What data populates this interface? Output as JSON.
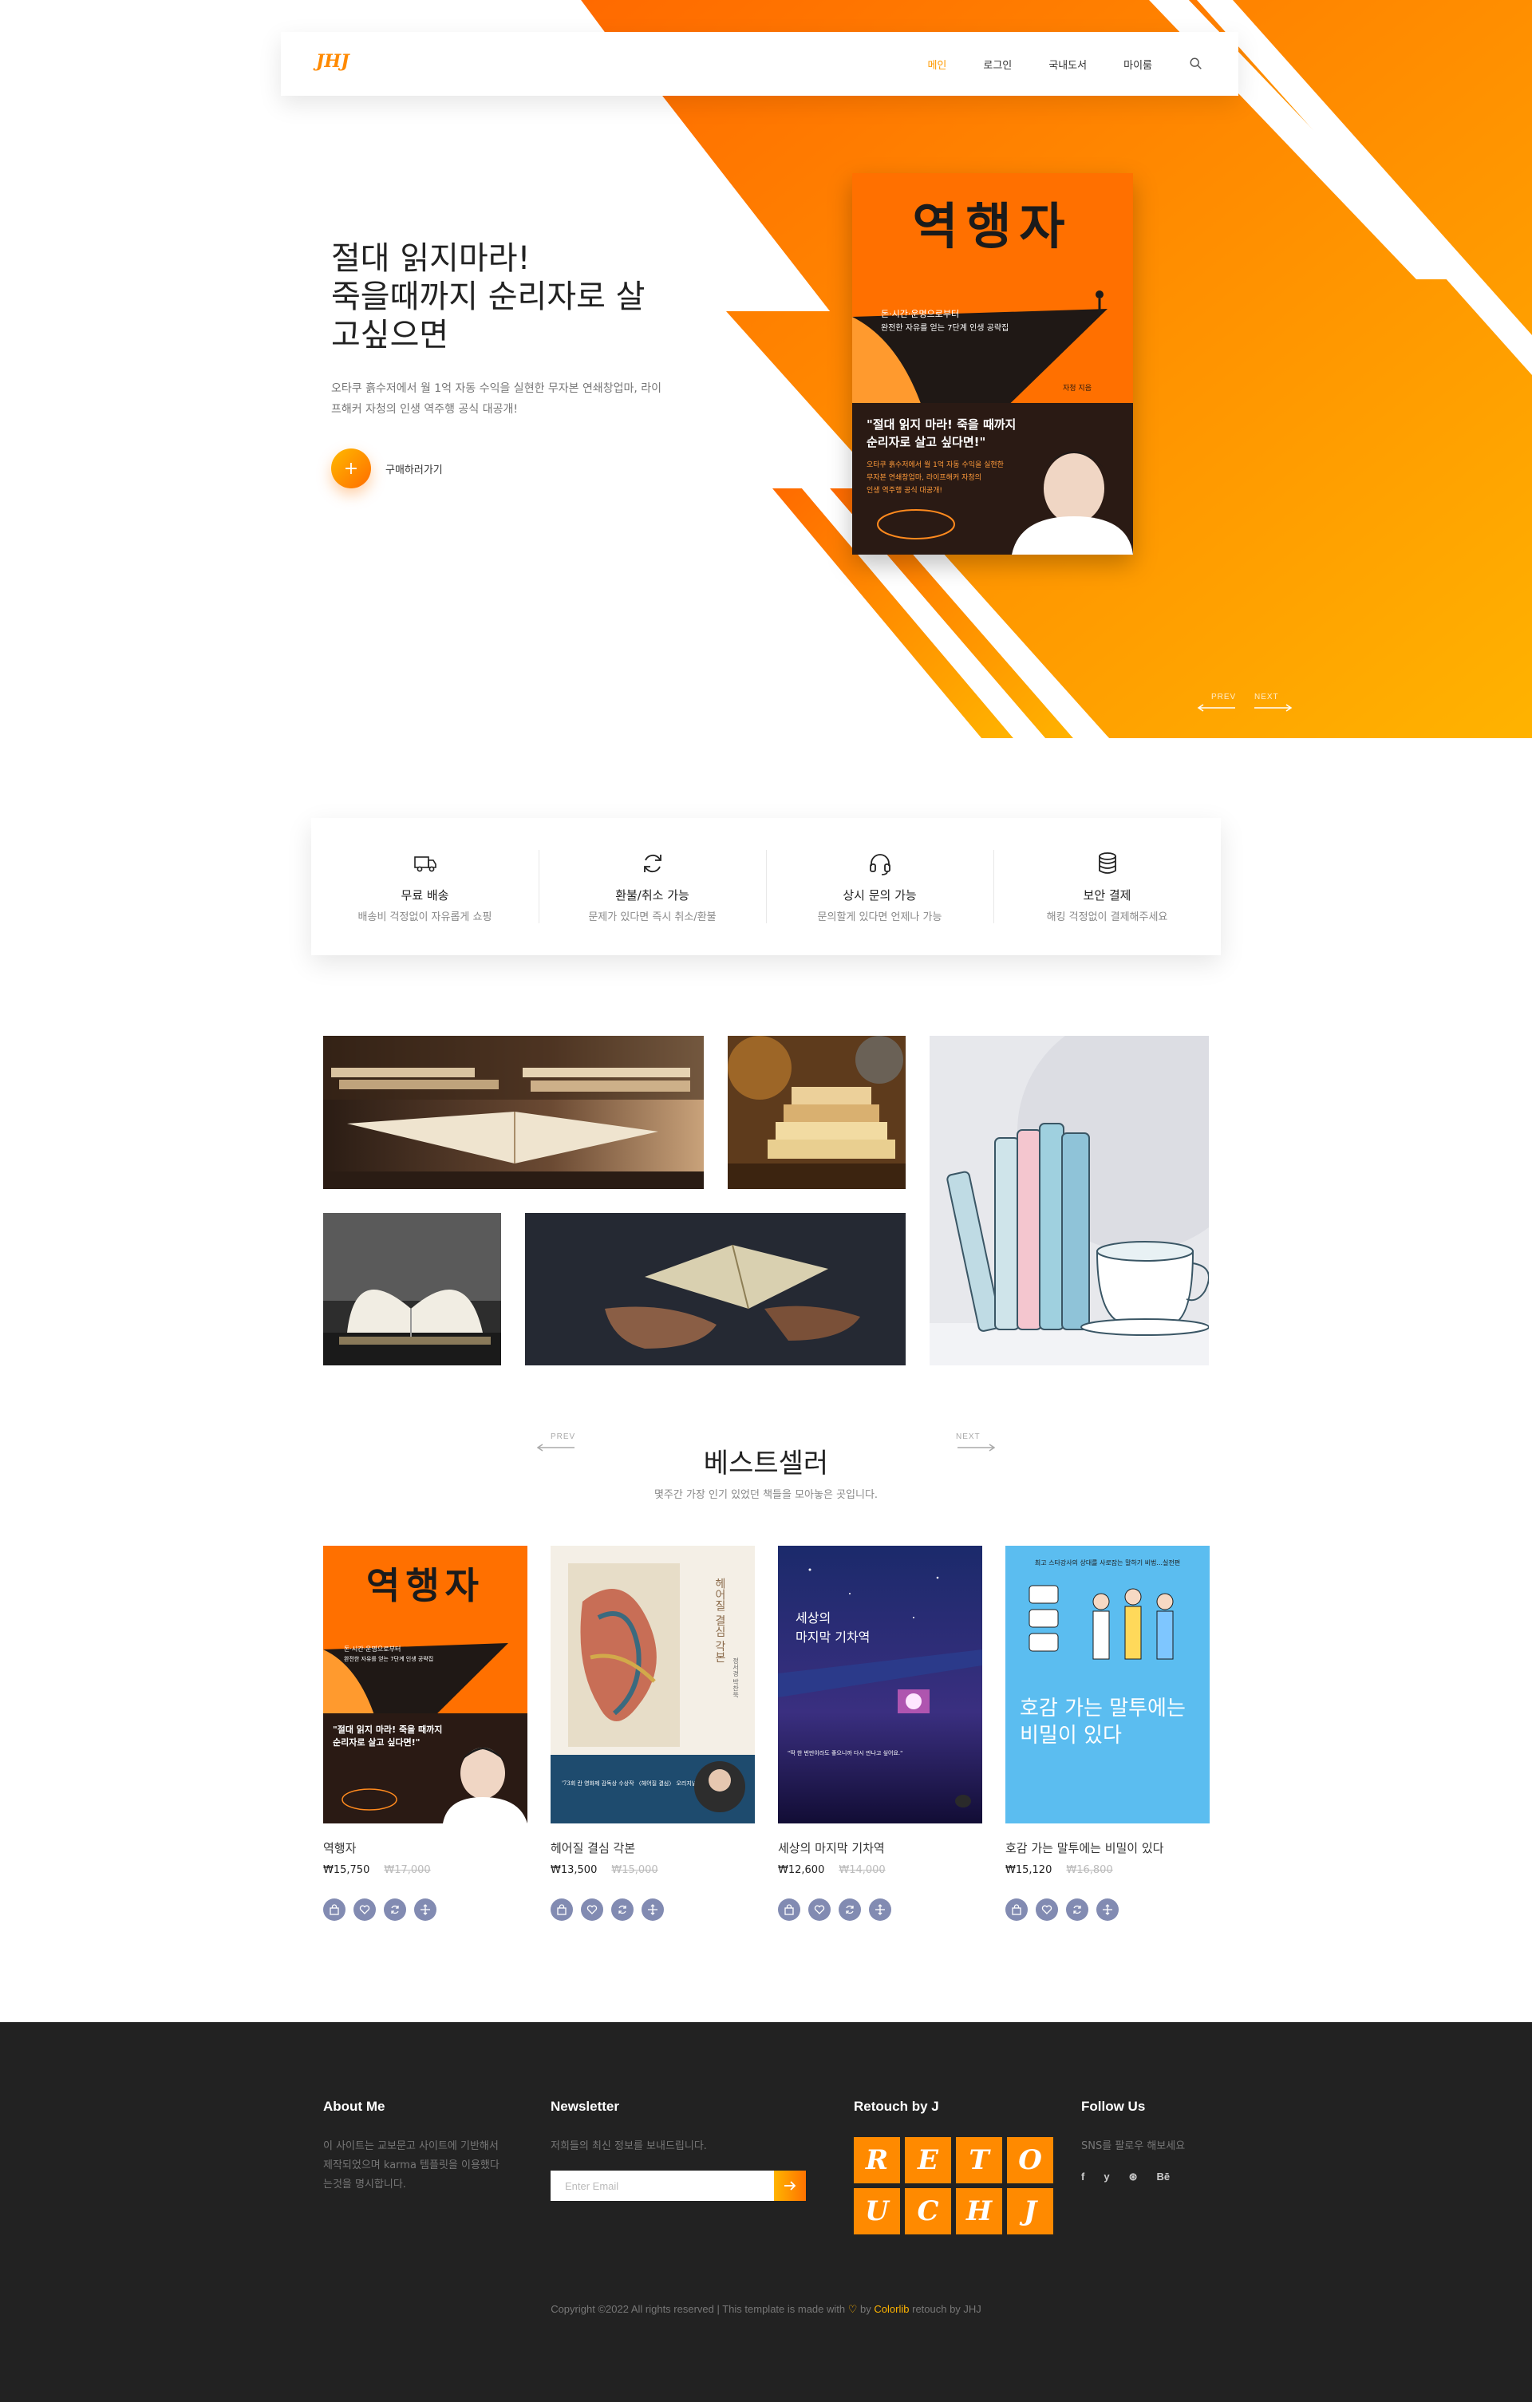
{
  "nav": {
    "logo": "JHJ",
    "items": [
      "메인",
      "로그인",
      "국내도서",
      "마이룸"
    ],
    "active_index": 0
  },
  "hero": {
    "title_lines": [
      "절대 읽지마라!",
      "죽을때까지 순리자로 살",
      "고싶으면"
    ],
    "desc_lines": [
      "오타쿠 흙수저에서 월 1억 자동 수익을 실현한 무자본 연쇄창업마, 라이",
      "프해커 자청의 인생 역주행 공식 대공개!"
    ],
    "cta_label": "구매하러가기",
    "prev": "PREV",
    "next": "NEXT",
    "book": {
      "title": "역행자",
      "tagline_1": "돈·시간·운명으로부터",
      "tagline_2": "완전한 자유를 얻는 7단계 인생 공략집",
      "author": "자청 지음",
      "quote_1": "\"절대 읽지 마라! 죽을 때까지",
      "quote_2": "순리자로 살고 싶다면!\"",
      "blurb_1": "오타쿠 흙수저에서 월 1억 자동 수익을 실현한",
      "blurb_2": "무자본 연쇄창업마, 라이프해커 자청의",
      "blurb_3": "인생 역주행 공식 대공개!"
    }
  },
  "features": [
    {
      "icon": "truck-icon",
      "title": "무료 배송",
      "sub": "배송비 걱정없이 자유롭게 쇼핑"
    },
    {
      "icon": "refresh-icon",
      "title": "환불/취소 가능",
      "sub": "문제가 있다면 즉시 취소/환불"
    },
    {
      "icon": "headphones-icon",
      "title": "상시 문의 가능",
      "sub": "문의할게 있다면 언제나 가능"
    },
    {
      "icon": "database-icon",
      "title": "보안 결제",
      "sub": "해킹 걱정없이 결제해주세요"
    }
  ],
  "bestseller": {
    "title": "베스트셀러",
    "subtitle": "몇주간 가장 인기 있었던 책들을 모아놓은 곳입니다.",
    "prev": "PREV",
    "next": "NEXT",
    "products": [
      {
        "name": "역행자",
        "price": "₩15,750",
        "old_price": "₩17,000"
      },
      {
        "name": "헤어질 결심 각본",
        "price": "₩13,500",
        "old_price": "₩15,000"
      },
      {
        "name": "세상의 마지막 기차역",
        "price": "₩12,600",
        "old_price": "₩14,000"
      },
      {
        "name": "호감 가는 말투에는 비밀이 있다",
        "price": "₩15,120",
        "old_price": "₩16,800"
      }
    ],
    "covers": {
      "c2_title": "헤어질 결심 각본",
      "c2_sub": "정서경 박찬욱",
      "c2_band": "'73회 칸 영화제 감독상 수상작 〈헤어질 결심〉 오리지널 각본",
      "c3_title_1": "세상의",
      "c3_title_2": "마지막 기차역",
      "c3_quote": "\"딱 한 번만이라도 좋으니까 다시 만나고 싶어요.\"",
      "c4_top": "최고 스타강사의 상대를 사로잡는 말하기 비법...실전편",
      "c4_title_1": "호감 가는 말투에는",
      "c4_title_2": "비밀이 있다"
    }
  },
  "footer": {
    "about_title": "About Me",
    "about_text": [
      "이 사이트는 교보문고 사이트에 기반해서",
      "제작되었으며 karma 템플릿을 이용했다",
      "는것을 명시합니다."
    ],
    "newsletter_title": "Newsletter",
    "newsletter_text": "저희들의 최신 정보를 보내드립니다.",
    "email_placeholder": "Enter Email",
    "retouch_title": "Retouch by J",
    "tiles": [
      "R",
      "E",
      "T",
      "O",
      "U",
      "C",
      "H",
      "J"
    ],
    "follow_title": "Follow Us",
    "follow_text": "SNS를 팔로우 해보세요",
    "socials": [
      "f",
      "y",
      "⊛",
      "Bē"
    ],
    "copyright_pre": "Copyright ©2022 All rights reserved | This template is made with",
    "copyright_by": "by",
    "copyright_brand": "Colorlib",
    "copyright_post": "retouch by JHJ"
  },
  "colors": {
    "orange": "#ff7b00",
    "orange_light": "#ffb400",
    "footer_bg": "#222222",
    "action_btn": "#828bb2"
  }
}
